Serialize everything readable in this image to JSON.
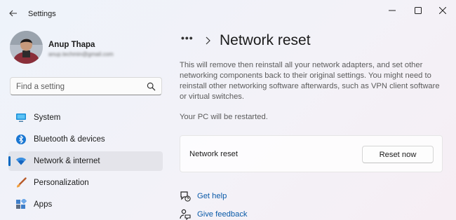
{
  "window": {
    "title": "Settings"
  },
  "profile": {
    "name": "Anup Thapa",
    "email": "anup.techmin@gmail.com"
  },
  "search": {
    "placeholder": "Find a setting"
  },
  "sidebar": {
    "items": [
      {
        "label": "System",
        "icon": "monitor-icon"
      },
      {
        "label": "Bluetooth & devices",
        "icon": "bluetooth-icon"
      },
      {
        "label": "Network & internet",
        "icon": "wifi-icon",
        "active": true
      },
      {
        "label": "Personalization",
        "icon": "brush-icon"
      },
      {
        "label": "Apps",
        "icon": "apps-icon"
      }
    ]
  },
  "breadcrumb": {
    "ellipsis": "•••",
    "title": "Network reset"
  },
  "content": {
    "description": "This will remove then reinstall all your network adapters, and set other networking components back to their original settings. You might need to reinstall other networking software afterwards, such as VPN client software or virtual switches.",
    "restart_note": "Your PC will be restarted."
  },
  "reset_card": {
    "label": "Network reset",
    "button": "Reset now"
  },
  "links": {
    "help": "Get help",
    "feedback": "Give feedback"
  },
  "colors": {
    "accent": "#0067c0",
    "link": "#0a5aa8"
  }
}
